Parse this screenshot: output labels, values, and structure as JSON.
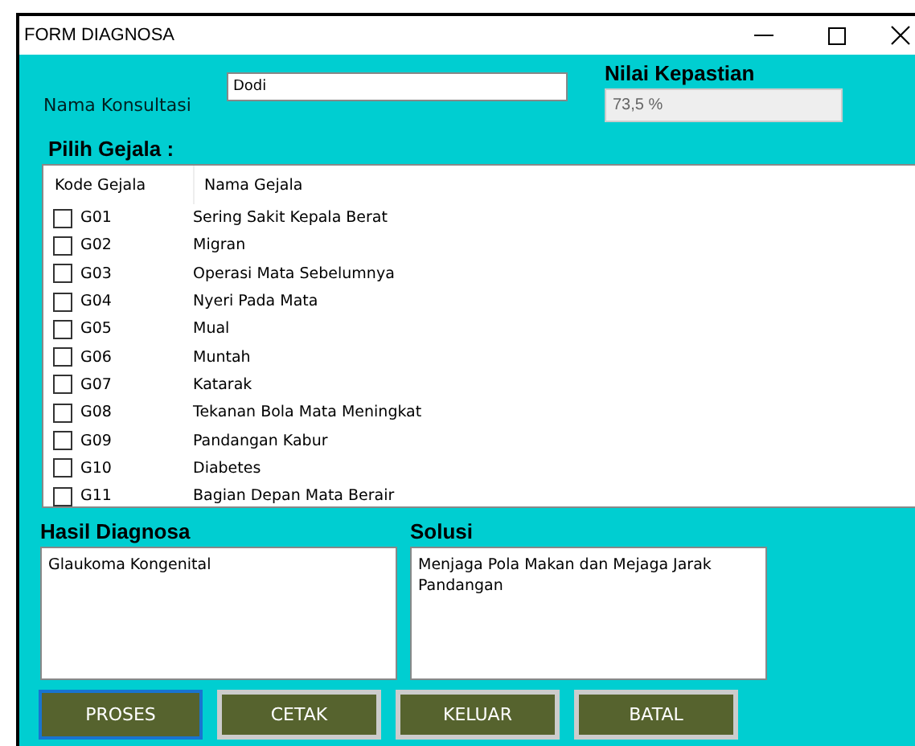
{
  "window": {
    "title": "FORM DIAGNOSA"
  },
  "consultation": {
    "label": "Nama Konsultasi",
    "value": "Dodi"
  },
  "certainty": {
    "label": "Nilai Kepastian",
    "value": "73,5 %"
  },
  "symptoms": {
    "label": "Pilih Gejala  :",
    "columns": [
      "Kode Gejala",
      "Nama Gejala"
    ],
    "rows": [
      {
        "code": "G01",
        "name": "Sering Sakit Kepala Berat",
        "checked": false
      },
      {
        "code": "G02",
        "name": "Migran",
        "checked": false
      },
      {
        "code": "G03",
        "name": "Operasi Mata Sebelumnya",
        "checked": false
      },
      {
        "code": "G04",
        "name": "Nyeri Pada Mata",
        "checked": false
      },
      {
        "code": "G05",
        "name": "Mual",
        "checked": false
      },
      {
        "code": "G06",
        "name": "Muntah",
        "checked": false
      },
      {
        "code": "G07",
        "name": "Katarak",
        "checked": false
      },
      {
        "code": "G08",
        "name": "Tekanan Bola Mata Meningkat",
        "checked": false
      },
      {
        "code": "G09",
        "name": "Pandangan Kabur",
        "checked": false
      },
      {
        "code": "G10",
        "name": "Diabetes",
        "checked": false
      },
      {
        "code": "G11",
        "name": "Bagian Depan Mata Berair",
        "checked": false
      }
    ]
  },
  "diagnosis": {
    "label": "Hasil Diagnosa",
    "value": "Glaukoma Kongenital"
  },
  "solution": {
    "label": "Solusi",
    "value": "Menjaga Pola Makan dan Mejaga Jarak Pandangan"
  },
  "buttons": [
    {
      "label": "PROSES",
      "selected": true
    },
    {
      "label": "CETAK",
      "selected": false
    },
    {
      "label": "KELUAR",
      "selected": false
    },
    {
      "label": "BATAL",
      "selected": false
    }
  ]
}
